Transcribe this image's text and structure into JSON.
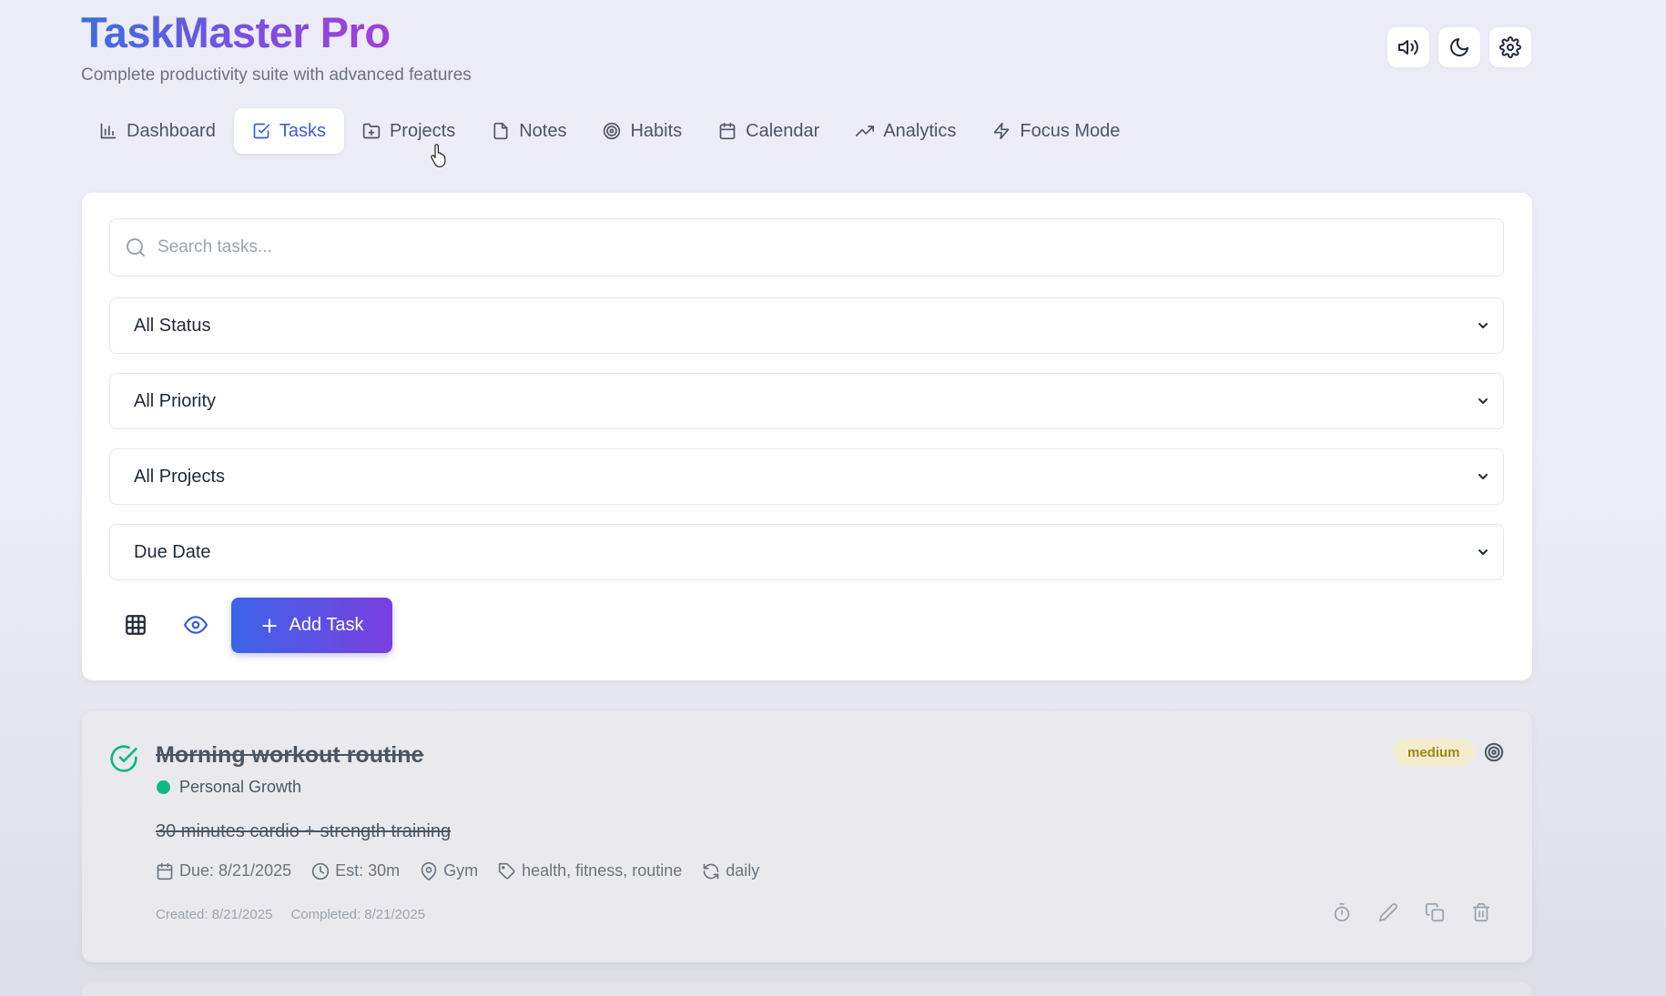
{
  "header": {
    "title": "TaskMaster Pro",
    "subtitle": "Complete productivity suite with advanced features",
    "actions": [
      {
        "icon": "volume-icon"
      },
      {
        "icon": "moon-icon"
      },
      {
        "icon": "gear-icon"
      }
    ]
  },
  "nav": {
    "active": "Tasks",
    "tabs": [
      {
        "label": "Dashboard",
        "icon": "bar-chart-icon"
      },
      {
        "label": "Tasks",
        "icon": "checkbox-icon"
      },
      {
        "label": "Projects",
        "icon": "folder-icon"
      },
      {
        "label": "Notes",
        "icon": "file-icon"
      },
      {
        "label": "Habits",
        "icon": "target-icon"
      },
      {
        "label": "Calendar",
        "icon": "calendar-icon"
      },
      {
        "label": "Analytics",
        "icon": "trending-up-icon"
      },
      {
        "label": "Focus Mode",
        "icon": "lightning-icon"
      }
    ]
  },
  "filters": {
    "search_placeholder": "Search tasks...",
    "search_value": "",
    "status": "All Status",
    "priority": "All Priority",
    "project": "All Projects",
    "sort": "Due Date"
  },
  "toolbar": {
    "add_task_label": "Add Task"
  },
  "tasks": [
    {
      "title": "Morning workout routine",
      "completed": true,
      "project": "Personal Growth",
      "project_color": "#10b981",
      "description": "30 minutes cardio + strength training",
      "due": "Due: 8/21/2025",
      "estimate": "Est: 30m",
      "location": "Gym",
      "tags": "health, fitness, routine",
      "recurrence": "daily",
      "created": "Created: 8/21/2025",
      "completed_on": "Completed: 8/21/2025",
      "priority": "medium"
    }
  ],
  "colors": {
    "accent": "#3b5bdb",
    "gradient_start": "#3c64e8",
    "gradient_end": "#7a3fe0",
    "success": "#10b981",
    "priority_medium_bg": "#f3eccd"
  }
}
